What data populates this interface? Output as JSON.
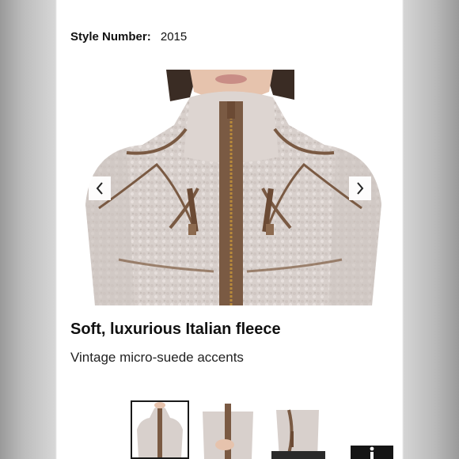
{
  "style": {
    "label": "Style Number:",
    "value": "2015"
  },
  "gallery": {
    "prev_icon": "chevron-left-icon",
    "next_icon": "chevron-right-icon",
    "thumbnail_count": 3,
    "selected_thumbnail": 1
  },
  "product": {
    "headline": "Soft, luxurious Italian fleece",
    "subheadline": "Vintage micro-suede accents"
  },
  "info_button": {
    "icon": "info-icon"
  },
  "colors": {
    "fleece": "#d9d1cd",
    "suede": "#7a5a43",
    "text": "#111111",
    "selected_border": "#1a1a1a"
  }
}
